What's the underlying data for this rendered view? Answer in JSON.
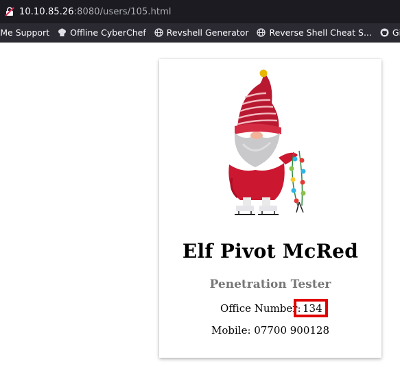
{
  "browser": {
    "url_host": "10.10.85.26",
    "url_rest": ":8080/users/105.html",
    "bookmarks": [
      {
        "label": "kMe Support",
        "icon": "none"
      },
      {
        "label": "Offline CyberChef",
        "icon": "chef-hat-icon"
      },
      {
        "label": "Revshell Generator",
        "icon": "globe-icon"
      },
      {
        "label": "Reverse Shell Cheat S...",
        "icon": "globe-icon"
      },
      {
        "label": "Git",
        "icon": "github-icon"
      }
    ]
  },
  "profile": {
    "image": "gnome-illustration",
    "name": "Elf Pivot McRed",
    "title": "Penetration Tester",
    "office_label": "Office Number:",
    "office_value": "134",
    "mobile": "Mobile: 07700 900128",
    "highlight_color": "#e10000"
  }
}
